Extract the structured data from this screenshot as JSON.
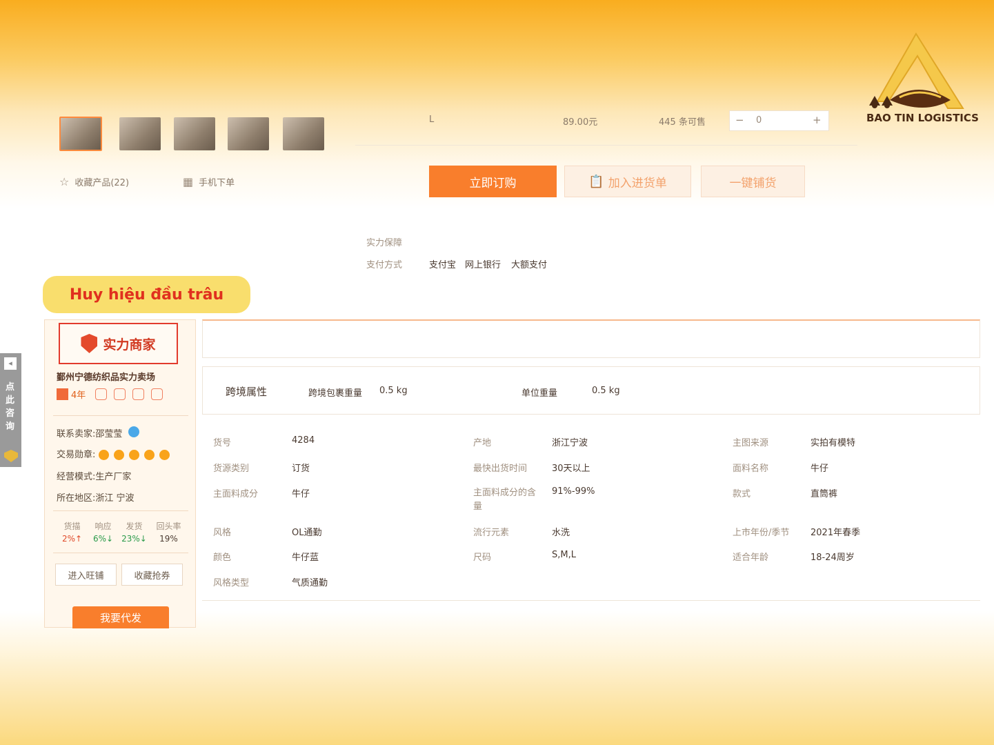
{
  "brand": {
    "logo_text": "BAO TIN LOGISTICS"
  },
  "sku_row": {
    "size": "L",
    "price": "89.00元",
    "stock": "445 条可售",
    "minus": "−",
    "quantity": "0",
    "plus": "+"
  },
  "links": {
    "favorite": "收藏产品(22)",
    "mobile_order": "手机下单"
  },
  "buttons": {
    "order_now": "立即订购",
    "add_to_cart": "加入进货单",
    "one_click": "一键铺货"
  },
  "payment": {
    "guarantee_label": "实力保障",
    "method_label": "支付方式",
    "methods": [
      "支付宝",
      "网上银行",
      "大额支付"
    ]
  },
  "annotation": {
    "label": "Huy hiệu đầu trâu"
  },
  "seller": {
    "badge": "实力商家",
    "shop_name": "鄞州宁德纺织品实力卖场",
    "years": "4年",
    "contact": "联系卖家:邵莹莹",
    "medal_label": "交易勋章:",
    "business_model": "经营模式:生产厂家",
    "location": "所在地区:浙江 宁波",
    "stats_headers": [
      "货描",
      "响应",
      "发货",
      "回头率"
    ],
    "stats_values": [
      "2%↑",
      "6%↓",
      "23%↓",
      "19%"
    ],
    "enter_shop": "进入旺铺",
    "save_coupon": "收藏抢券",
    "dropship": "我要代发"
  },
  "side_tab": {
    "label": "点此咨询"
  },
  "cross_border": {
    "title": "跨境属性",
    "pkg_weight_label": "跨境包裹重量",
    "pkg_weight": "0.5 kg",
    "unit_weight_label": "单位重量",
    "unit_weight": "0.5 kg"
  },
  "attributes": [
    {
      "k": "货号",
      "v": "4284"
    },
    {
      "k": "产地",
      "v": "浙江宁波"
    },
    {
      "k": "主图来源",
      "v": "实拍有模特"
    },
    {
      "k": "货源类别",
      "v": "订货"
    },
    {
      "k": "最快出货时间",
      "v": "30天以上"
    },
    {
      "k": "面料名称",
      "v": "牛仔"
    },
    {
      "k": "主面料成分",
      "v": "牛仔"
    },
    {
      "k": "主面料成分的含量",
      "v": "91%-99%"
    },
    {
      "k": "款式",
      "v": "直筒裤"
    },
    {
      "k": "风格",
      "v": "OL通勤"
    },
    {
      "k": "流行元素",
      "v": "水洗"
    },
    {
      "k": "上市年份/季节",
      "v": "2021年春季"
    },
    {
      "k": "颜色",
      "v": "牛仔蓝"
    },
    {
      "k": "尺码",
      "v": "S,M,L"
    },
    {
      "k": "适合年龄",
      "v": "18-24周岁"
    },
    {
      "k": "风格类型",
      "v": "气质通勤"
    }
  ],
  "colors": {
    "accent": "#f97e2c",
    "highlight": "#e23a2c",
    "label_bg": "#f9de6d"
  }
}
